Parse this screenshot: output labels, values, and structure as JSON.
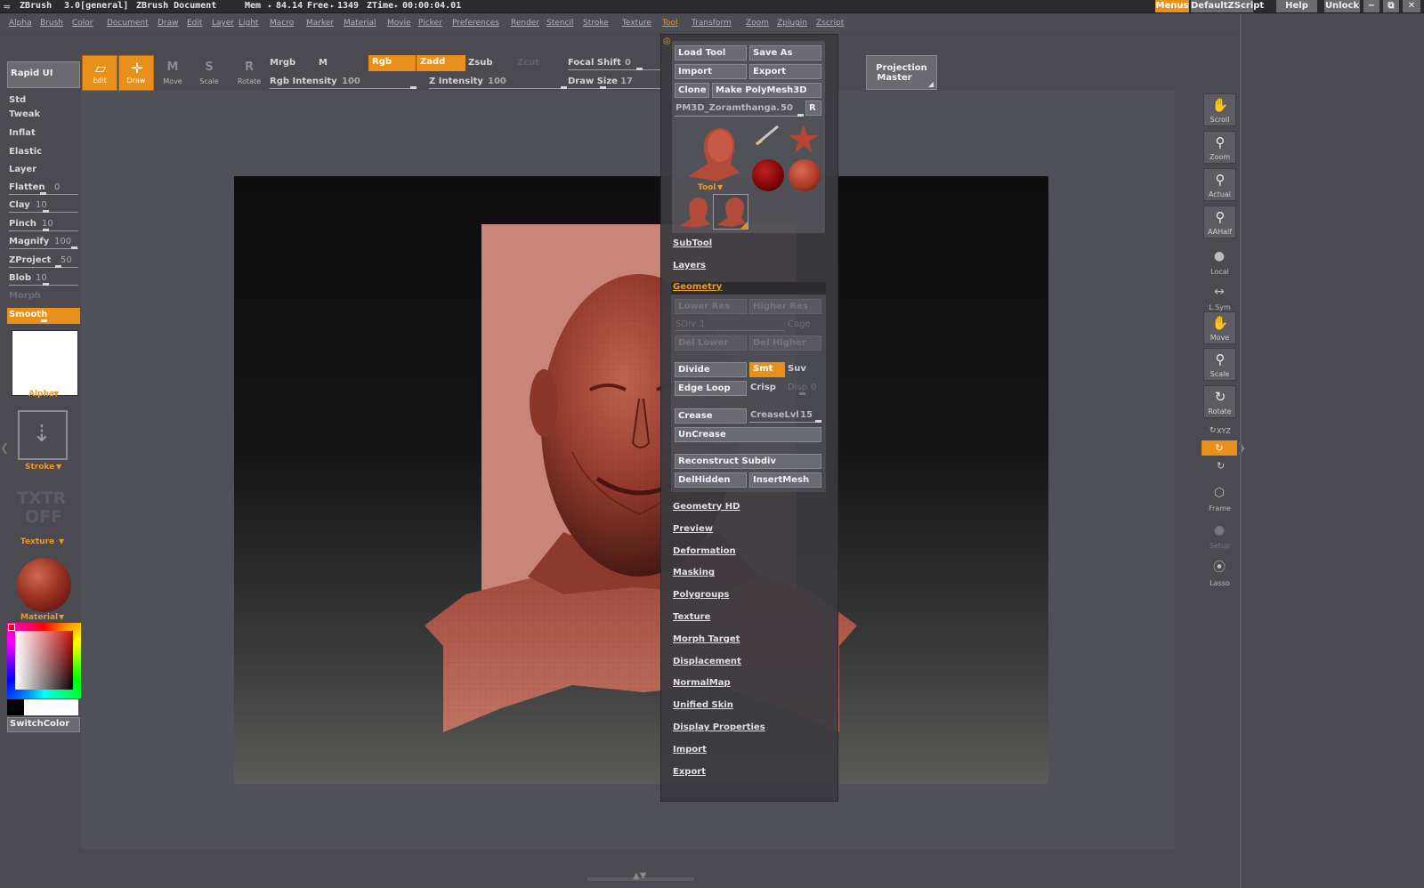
{
  "titlebar": {
    "app": "ZBrush",
    "version": "3.0[general]",
    "document": "ZBrush Document",
    "mem_label": "Mem",
    "mem_value": "84.14",
    "free_label": "Free",
    "free_value": "1349",
    "ztime_label": "ZTime",
    "ztime_value": "00:00:04.01",
    "menus_button": "Menus",
    "script_button": "DefaultZScript",
    "help_button": "Help",
    "unlock_button": "Unlock"
  },
  "menubar": {
    "items": [
      "Alpha",
      "Brush",
      "Color",
      "Document",
      "Draw",
      "Edit",
      "Layer",
      "Light",
      "Macro",
      "Marker",
      "Material",
      "Movie",
      "Picker",
      "Preferences",
      "Render",
      "Stencil",
      "Stroke",
      "Texture",
      "Tool",
      "Transform",
      "Zoom",
      "Zplugin",
      "Zscript"
    ],
    "active": "Tool"
  },
  "left": {
    "rapid_ui": "Rapid UI",
    "brushes": [
      "Std",
      "Tweak",
      "Inflat",
      "Elastic",
      "Layer"
    ],
    "sliders": [
      {
        "label": "Flatten",
        "value": "0"
      },
      {
        "label": "Clay",
        "value": "10"
      },
      {
        "label": "Pinch",
        "value": "10"
      },
      {
        "label": "Magnify",
        "value": "100"
      },
      {
        "label": "ZProject",
        "value": "50"
      },
      {
        "label": "Blob",
        "value": "10"
      }
    ],
    "morph": "Morph",
    "smooth": "Smooth",
    "alpha_label": "Alpha",
    "stroke_label": "Stroke",
    "texture_off_1": "TXTR",
    "texture_off_2": "OFF",
    "texture_label": "Texture",
    "material_label": "Material",
    "switch_color": "SwitchColor"
  },
  "toolbar": {
    "edit": "Edit",
    "draw": "Draw",
    "move": "Move",
    "scale": "Scale",
    "rotate": "Rotate",
    "mrgb": "Mrgb",
    "m": "M",
    "rgb": "Rgb",
    "zadd": "Zadd",
    "zsub": "Zsub",
    "zcut": "Zcut",
    "rgb_intensity_label": "Rgb Intensity",
    "rgb_intensity_value": "100",
    "z_intensity_label": "Z Intensity",
    "z_intensity_value": "100",
    "focal_shift_label": "Focal Shift",
    "focal_shift_value": "0",
    "draw_size_label": "Draw Size",
    "draw_size_value": "17",
    "projection_master_1": "Projection",
    "projection_master_2": "Master"
  },
  "right_shelf": {
    "scroll": "Scroll",
    "zoom": "Zoom",
    "actual": "Actual",
    "aahalf": "AAHalf",
    "local": "Local",
    "lsym": "L.Sym",
    "move": "Move",
    "scale": "Scale",
    "rotate": "Rotate",
    "xyz": "XYZ",
    "frame": "Frame",
    "setup": "Setup",
    "lasso": "Lasso"
  },
  "tool_palette": {
    "load_tool": "Load Tool",
    "save_as": "Save As",
    "import": "Import",
    "export": "Export",
    "clone": "Clone",
    "make_polymesh": "Make PolyMesh3D",
    "current_tool_name": "PM3D_Zoramthanga.",
    "current_tool_value": "50",
    "r_button": "R",
    "tool_label": "Tool",
    "subtool": "SubTool",
    "layers": "Layers",
    "geometry": "Geometry",
    "lower_res": "Lower Res",
    "higher_res": "Higher Res",
    "sdiv": "SDiv",
    "sdiv_value": "1",
    "cage": "Cage",
    "del_lower": "Del Lower",
    "del_higher": "Del Higher",
    "divide": "Divide",
    "smt": "Smt",
    "suv": "Suv",
    "edge_loop": "Edge Loop",
    "crisp": "Crisp",
    "disp": "Disp",
    "disp_value": "0",
    "crease": "Crease",
    "creaselvl_label": "CreaseLvl",
    "creaselvl_value": "15",
    "uncrease": "UnCrease",
    "reconstruct_subdiv": "Reconstruct Subdiv",
    "delhidden": "DelHidden",
    "insertmesh": "InsertMesh",
    "sections": [
      "Geometry HD",
      "Preview",
      "Deformation",
      "Masking",
      "Polygroups",
      "Texture",
      "Morph Target",
      "Displacement",
      "NormalMap",
      "Unified Skin",
      "Display Properties",
      "Import",
      "Export"
    ]
  },
  "colors": {
    "accent": "#e8901a",
    "model_skin": "#a04a3c",
    "plane_color": "#c98577"
  }
}
